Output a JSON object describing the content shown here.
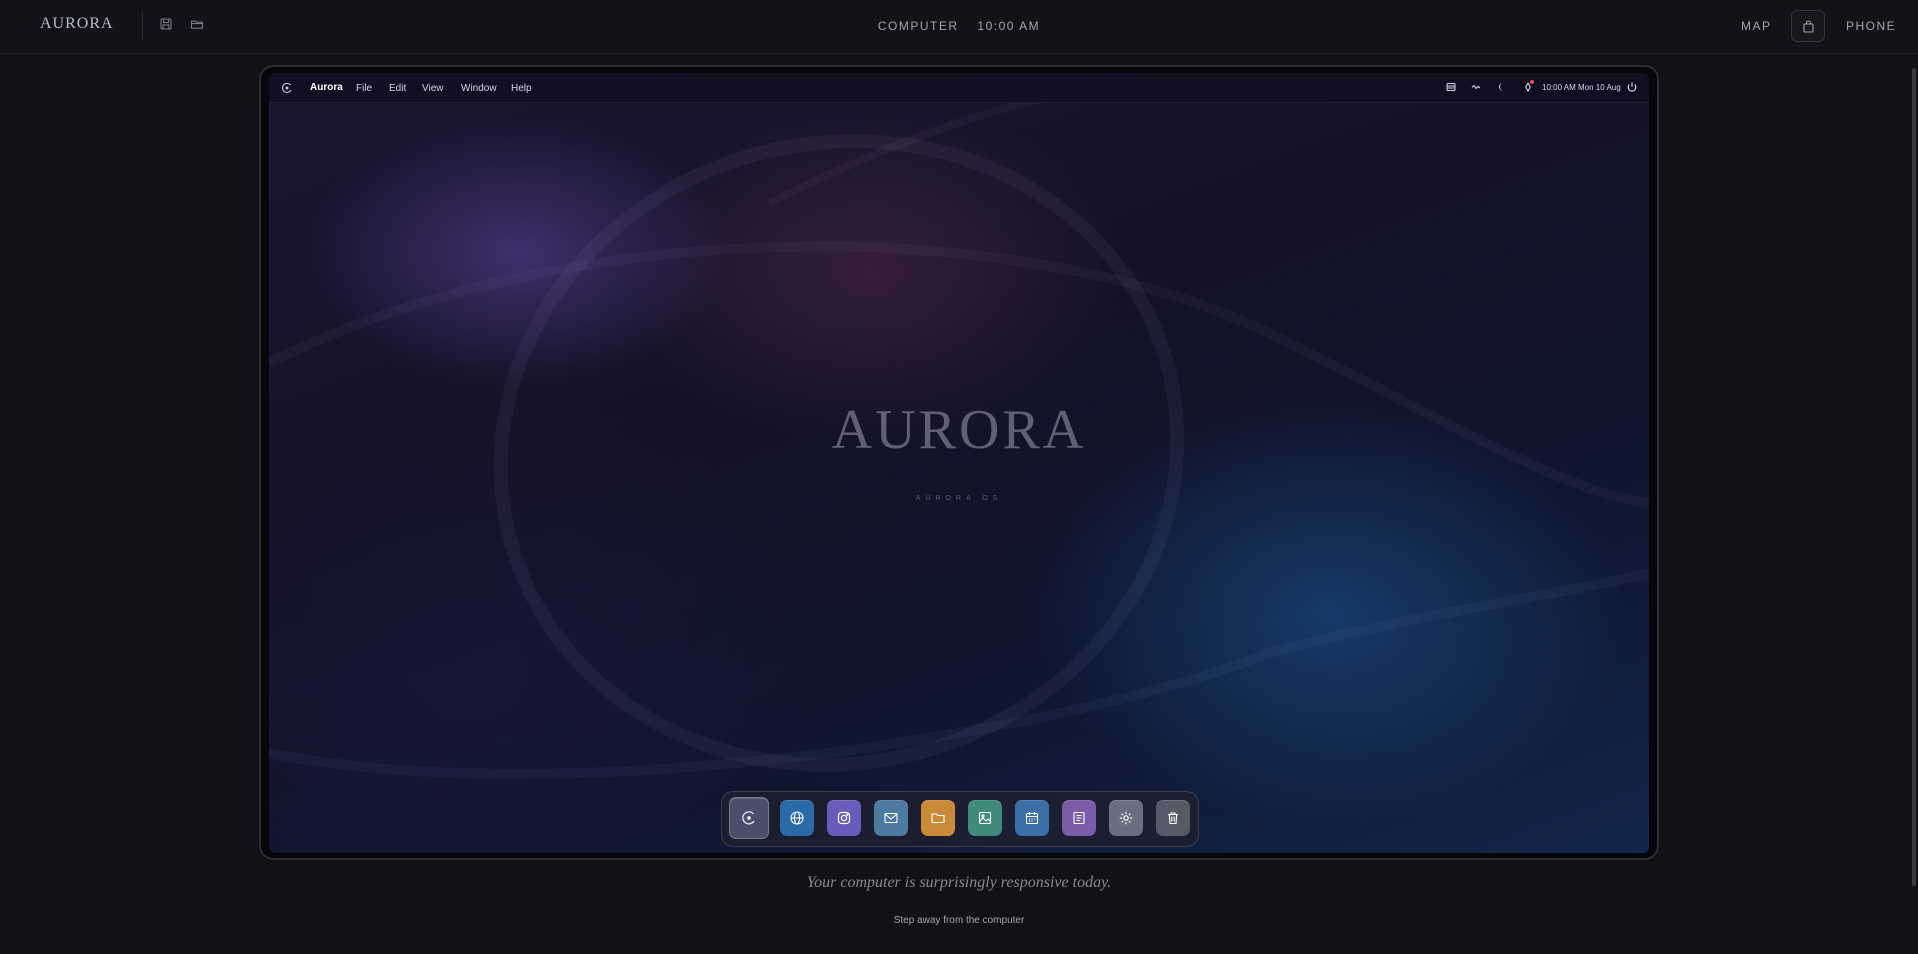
{
  "app": {
    "brand": "AURORA",
    "header": {
      "mode_label": "COMPUTER",
      "time": "10:00 AM",
      "map_label": "MAP",
      "phone_label": "PHONE"
    }
  },
  "desktop": {
    "menubar": {
      "app_name": "Aurora",
      "menus": [
        "File",
        "Edit",
        "View",
        "Window",
        "Help"
      ],
      "time": "10:00 AM",
      "date": "Mon 10 Aug"
    },
    "wallpaper": {
      "wordmark": "AURORA",
      "subtitle": "AURORA OS"
    },
    "dock": {
      "items": [
        {
          "icon": "aurora-launcher-icon",
          "color": "#4a4f6b"
        },
        {
          "icon": "globe-icon",
          "color": "#2a6aa8"
        },
        {
          "icon": "instagram-icon",
          "color": "#6a5cbc"
        },
        {
          "icon": "mail-icon",
          "color": "#4d7aa0"
        },
        {
          "icon": "folder-icon",
          "color": "#c98a3a"
        },
        {
          "icon": "photos-icon",
          "color": "#3f8a7a"
        },
        {
          "icon": "calendar-icon",
          "color": "#3a6fa8"
        },
        {
          "icon": "notes-icon",
          "color": "#7a5ca8"
        },
        {
          "icon": "settings-icon",
          "color": "#6a6f80"
        },
        {
          "icon": "trash-icon",
          "color": "#555a66"
        }
      ]
    }
  },
  "caption": "Your computer is surprisingly responsive today.",
  "footer_action": "Step away from the computer"
}
